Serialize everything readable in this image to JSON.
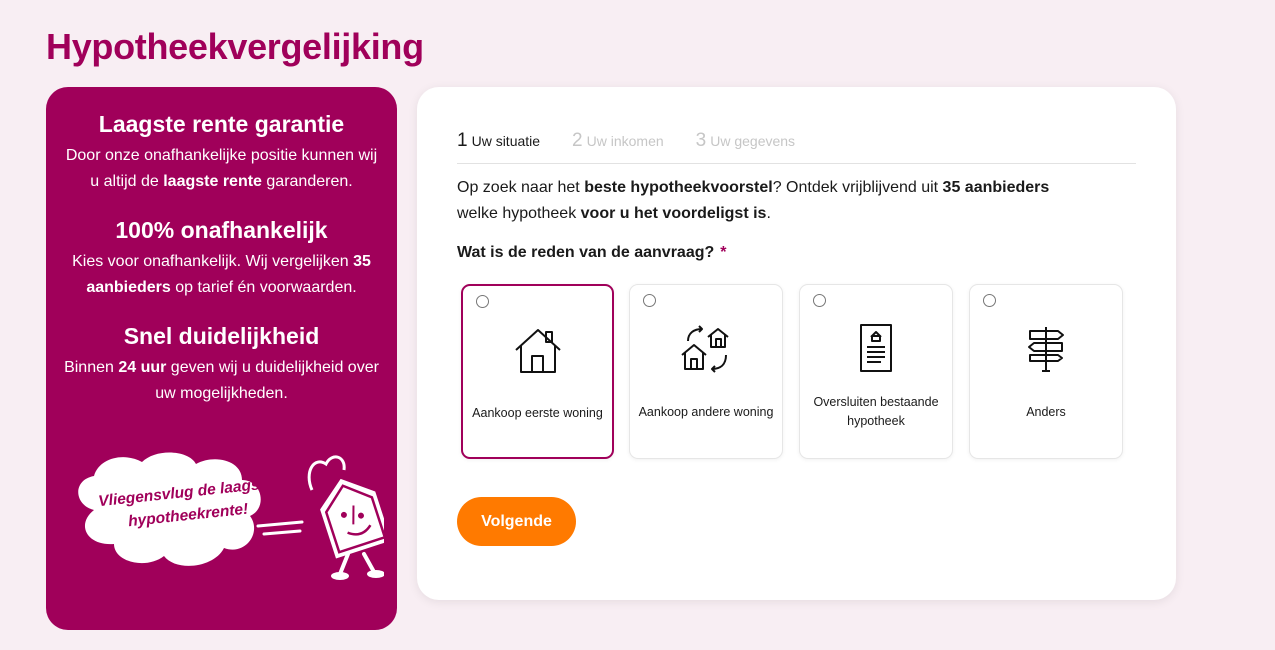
{
  "page": {
    "title": "Hypotheekvergelijking"
  },
  "sidebar": {
    "usps": [
      {
        "title": "Laagste rente garantie",
        "text_parts": [
          "Door onze onafhankelijke positie kunnen wij u altijd de ",
          "laagste rente",
          " garanderen."
        ]
      },
      {
        "title": "100% onafhankelijk",
        "text_parts": [
          "Kies voor onafhankelijk. Wij vergelijken ",
          "35 aanbieders",
          " op tarief én voorwaarden."
        ]
      },
      {
        "title": "Snel duidelijkheid",
        "text_parts": [
          "Binnen ",
          "24 uur",
          " geven wij u duidelijkheid over uw mogelijkheden."
        ]
      }
    ],
    "slogan_line1": "Vliegensvlug de laagste",
    "slogan_line2": "hypotheekrente!"
  },
  "steps": [
    {
      "num": "1",
      "label": "Uw situatie",
      "active": true
    },
    {
      "num": "2",
      "label": "Uw inkomen",
      "active": false
    },
    {
      "num": "3",
      "label": "Uw gegevens",
      "active": false
    }
  ],
  "intro": {
    "p1": "Op zoek naar het ",
    "b1": "beste hypotheekvoorstel",
    "p2": "? Ontdek vrijblijvend uit ",
    "b2": "35 aanbieders",
    "p3": " welke hypotheek ",
    "b3": "voor u het voordeligst is",
    "p4": "."
  },
  "question": {
    "label": "Wat is de reden van de aanvraag?",
    "required_mark": "*"
  },
  "options": [
    {
      "label": "Aankoop eerste woning",
      "icon": "house-icon",
      "selected": true
    },
    {
      "label": "Aankoop andere woning",
      "icon": "house-swap-icon",
      "selected": false
    },
    {
      "label": "Oversluiten bestaande hypotheek",
      "icon": "document-icon",
      "selected": false
    },
    {
      "label": "Anders",
      "icon": "signpost-icon",
      "selected": false
    }
  ],
  "buttons": {
    "next_label": "Volgende"
  },
  "colors": {
    "brand": "#a0005a",
    "accent": "#ff7a00",
    "background": "#f8eef3"
  }
}
